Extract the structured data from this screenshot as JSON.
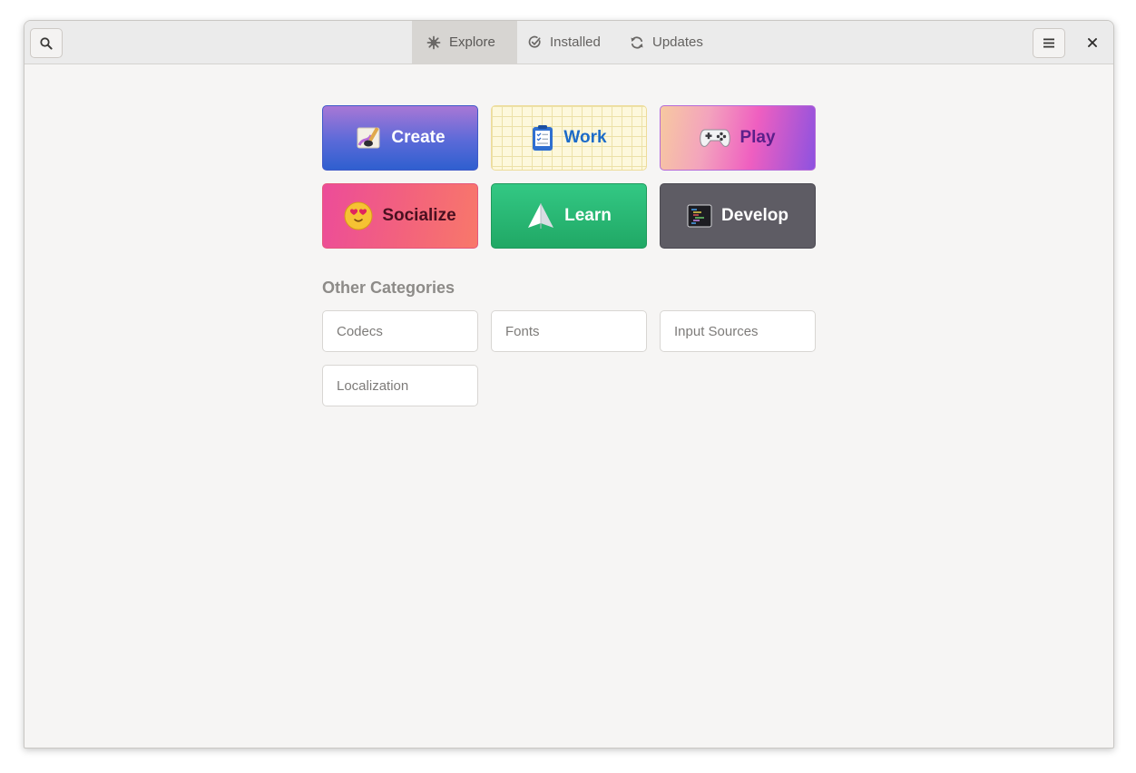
{
  "header": {
    "search_icon": "search-icon",
    "menu_icon": "hamburger-menu-icon",
    "close_icon": "close-icon",
    "tabs": [
      {
        "label": "Explore",
        "icon": "explore-icon",
        "active": true
      },
      {
        "label": "Installed",
        "icon": "check-circle-icon",
        "active": false
      },
      {
        "label": "Updates",
        "icon": "refresh-icon",
        "active": false
      }
    ]
  },
  "main": {
    "featured_categories": [
      {
        "label": "Create",
        "icon": "create-art-icon",
        "color": "#4a63d6"
      },
      {
        "label": "Work",
        "icon": "clipboard-checklist-icon",
        "color": "#1c6bc8"
      },
      {
        "label": "Play",
        "icon": "gamepad-icon",
        "color": "#5b1f8a"
      },
      {
        "label": "Socialize",
        "icon": "heart-eyes-emoji-icon",
        "color": "#4a1020"
      },
      {
        "label": "Learn",
        "icon": "paper-plane-icon",
        "color": "#ffffff"
      },
      {
        "label": "Develop",
        "icon": "terminal-code-icon",
        "color": "#ffffff"
      }
    ],
    "other_title": "Other Categories",
    "other_categories": [
      {
        "label": "Codecs"
      },
      {
        "label": "Fonts"
      },
      {
        "label": "Input Sources"
      },
      {
        "label": "Localization"
      }
    ]
  },
  "colors": {
    "window_bg": "#f6f5f4",
    "headerbar_bg": "#ebebeb",
    "active_tab_bg": "#d7d5d2"
  }
}
